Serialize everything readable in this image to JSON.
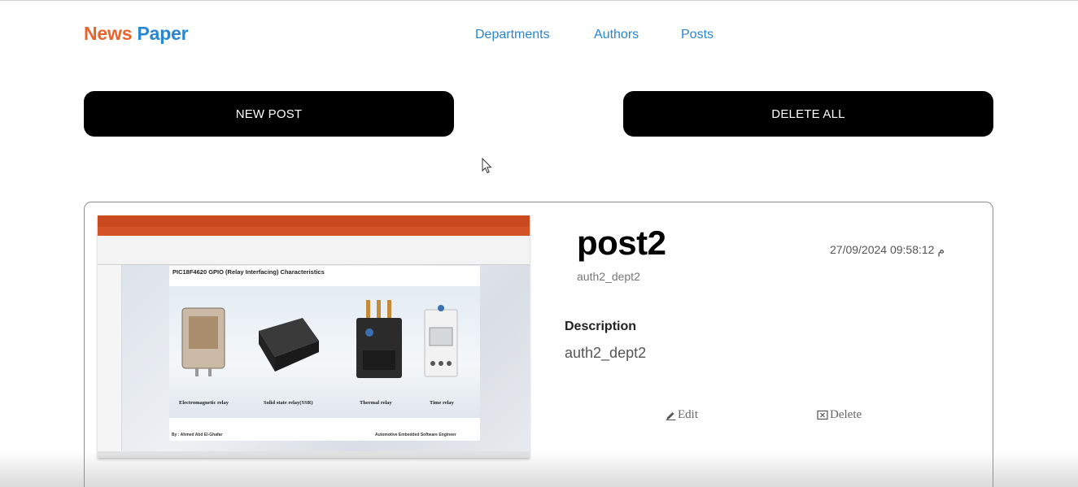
{
  "navbar": {
    "brand_part1": "News",
    "brand_part2": "Paper",
    "links": [
      {
        "label": "Departments"
      },
      {
        "label": "Authors"
      },
      {
        "label": "Posts"
      }
    ]
  },
  "actions": {
    "new_post_label": "NEW POST",
    "delete_all_label": "DELETE ALL"
  },
  "post": {
    "title": "post2",
    "date": "27/09/2024 09:58:12 م",
    "author_dept": "auth2_dept2",
    "description_label": "Description",
    "description": "auth2_dept2",
    "edit_label": "Edit",
    "delete_label": "Delete",
    "image": {
      "slide_title": "PIC18F4620 GPIO (Relay Interfacing) Characteristics",
      "captions": [
        "Electromagnetic relay",
        "Solid state relay(SSR)",
        "Thermal relay",
        "Time relay"
      ],
      "footer_left": "By : Ahmed Abd El-Ghafar",
      "footer_right": "Automotive Embedded Software Engineer"
    }
  },
  "colors": {
    "brand_orange": "#e8642b",
    "brand_blue": "#2a86d1",
    "button_bg": "#000000",
    "button_text": "#ffffff"
  }
}
